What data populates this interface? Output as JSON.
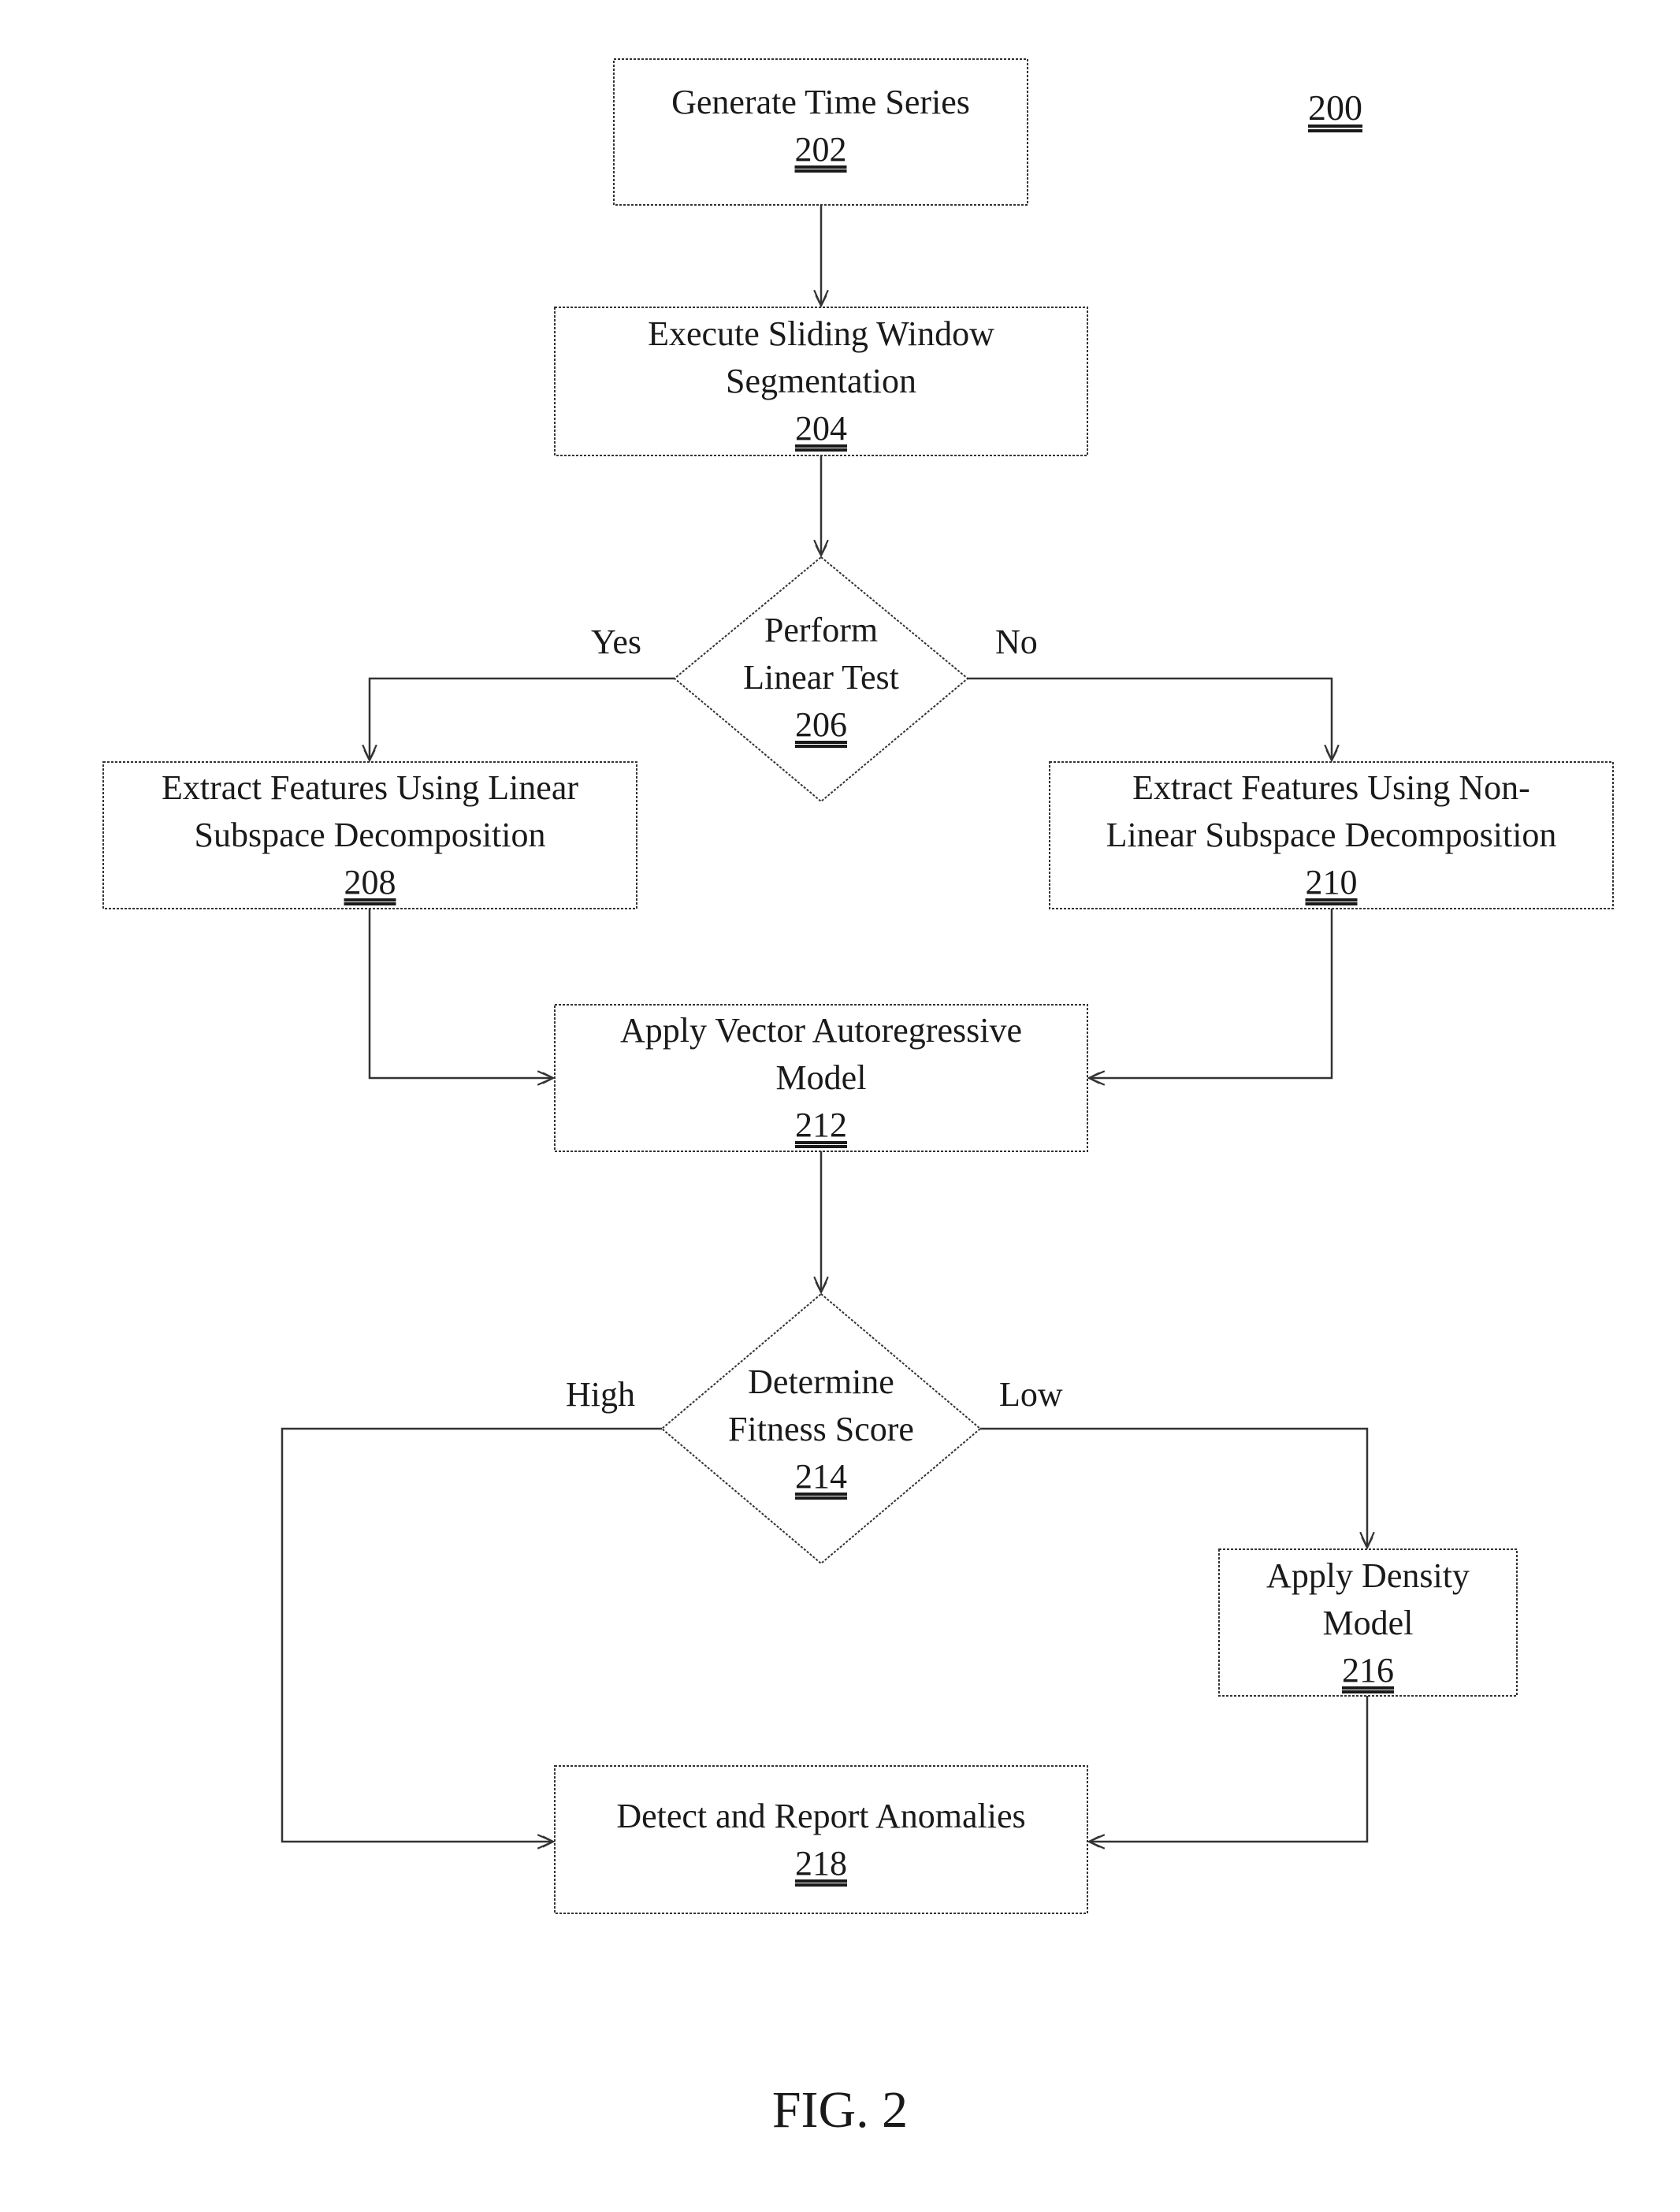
{
  "figure": {
    "reference": "200",
    "caption": "FIG. 2"
  },
  "nodes": [
    {
      "id": "n202",
      "type": "process",
      "label": "Generate Time Series",
      "ref": "202"
    },
    {
      "id": "n204",
      "type": "process",
      "label": "Execute Sliding Window Segmentation",
      "lines": [
        "Execute Sliding Window",
        "Segmentation"
      ],
      "ref": "204"
    },
    {
      "id": "n206",
      "type": "decision",
      "label": "Perform Linear Test",
      "lines": [
        "Perform",
        "Linear Test"
      ],
      "ref": "206"
    },
    {
      "id": "n208",
      "type": "process",
      "label": "Extract Features Using Linear Subspace Decomposition",
      "lines": [
        "Extract Features Using Linear",
        "Subspace Decomposition"
      ],
      "ref": "208"
    },
    {
      "id": "n210",
      "type": "process",
      "label": "Extract Features Using Non-Linear Subspace Decomposition",
      "lines": [
        "Extract Features Using Non-",
        "Linear Subspace Decomposition"
      ],
      "ref": "210"
    },
    {
      "id": "n212",
      "type": "process",
      "label": "Apply Vector Autoregressive Model",
      "lines": [
        "Apply Vector Autoregressive",
        "Model"
      ],
      "ref": "212"
    },
    {
      "id": "n214",
      "type": "decision",
      "label": "Determine Fitness Score",
      "lines": [
        "Determine",
        "Fitness Score"
      ],
      "ref": "214"
    },
    {
      "id": "n216",
      "type": "process",
      "label": "Apply Density Model",
      "lines": [
        "Apply Density",
        "Model"
      ],
      "ref": "216"
    },
    {
      "id": "n218",
      "type": "process",
      "label": "Detect and Report Anomalies",
      "ref": "218"
    }
  ],
  "edges": [
    {
      "from": "n202",
      "to": "n204",
      "label": ""
    },
    {
      "from": "n204",
      "to": "n206",
      "label": ""
    },
    {
      "from": "n206",
      "to": "n208",
      "label": "Yes"
    },
    {
      "from": "n206",
      "to": "n210",
      "label": "No"
    },
    {
      "from": "n208",
      "to": "n212",
      "label": ""
    },
    {
      "from": "n210",
      "to": "n212",
      "label": ""
    },
    {
      "from": "n212",
      "to": "n214",
      "label": ""
    },
    {
      "from": "n214",
      "to": "n218",
      "label": "High"
    },
    {
      "from": "n214",
      "to": "n216",
      "label": "Low"
    },
    {
      "from": "n216",
      "to": "n218",
      "label": ""
    }
  ],
  "labels": {
    "yes": "Yes",
    "no": "No",
    "high": "High",
    "low": "Low"
  }
}
